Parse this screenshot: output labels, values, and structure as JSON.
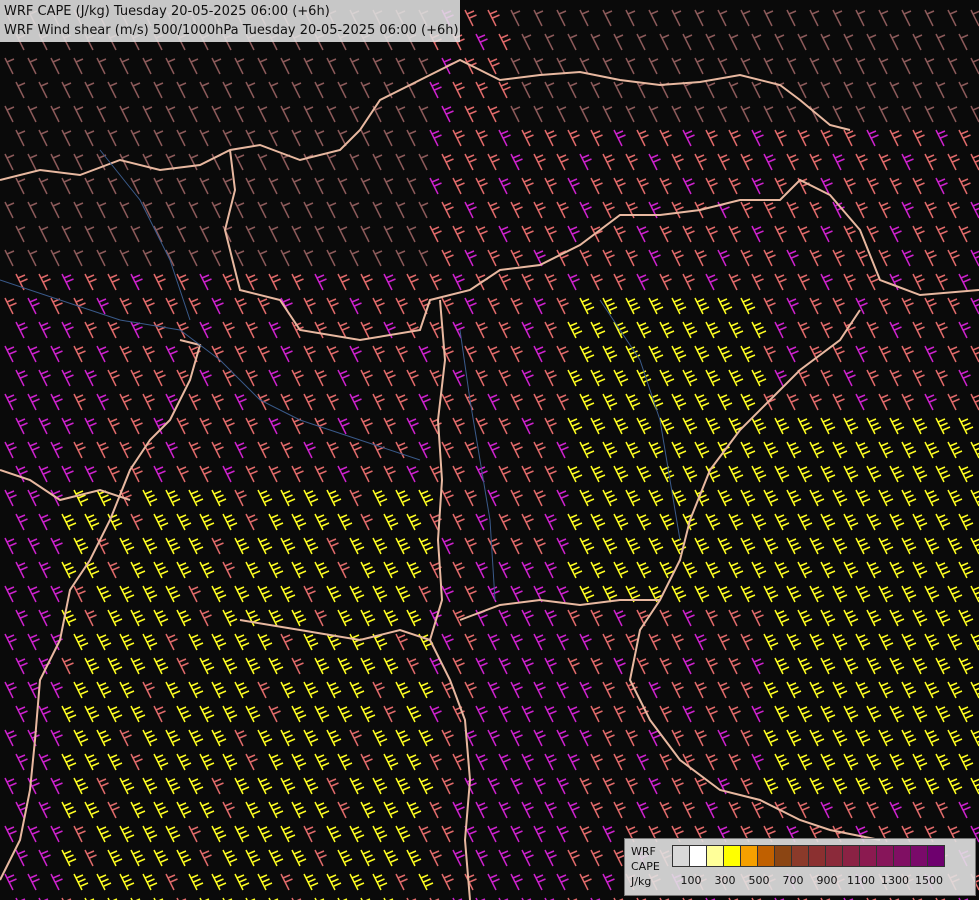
{
  "header": {
    "line1": "WRF CAPE (J/kg) Tuesday 20-05-2025 06:00 (+6h)",
    "line2": "WRF Wind shear (m/s) 500/1000hPa Tuesday 20-05-2025 06:00 (+6h)"
  },
  "legend": {
    "title_line1": "WRF",
    "title_line2": "CAPE",
    "unit": "J/kg",
    "colors": [
      "#d9d9d9",
      "#ffffff",
      "#ffff99",
      "#ffff00",
      "#f5a000",
      "#c06000",
      "#8b4513",
      "#8b3a2a",
      "#8b3030",
      "#8b2a3a",
      "#8b2244",
      "#8b1a50",
      "#87155a",
      "#800f63",
      "#7a0a6a",
      "#6e006e"
    ],
    "ticks": [
      "100",
      "300",
      "500",
      "700",
      "900",
      "1100",
      "1300",
      "1500"
    ]
  },
  "barb_colors": {
    "weak": "#8c5a5a",
    "moderate": "#e06a6a",
    "strong": "#cc22cc",
    "very_strong": "#ffff22"
  },
  "map_colors": {
    "borders": "#e8b8a0",
    "rivers": "#3a5a8a",
    "background": "#0a0a0a"
  }
}
